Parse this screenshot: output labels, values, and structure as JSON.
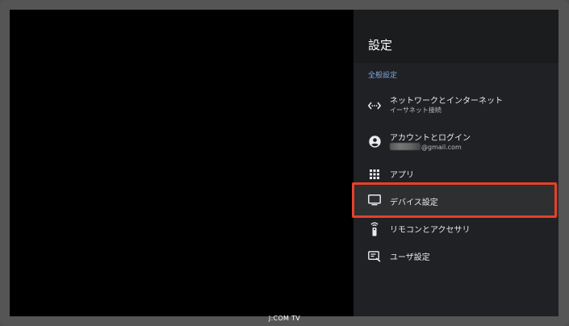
{
  "panel": {
    "title": "設定",
    "section": "全般設定",
    "items": [
      {
        "label": "ネットワークとインターネット",
        "sub": "イーサネット接続",
        "icon": "network-icon"
      },
      {
        "label": "アカウントとログイン",
        "sub": "@gmail.com",
        "icon": "account-icon"
      },
      {
        "label": "アプリ",
        "icon": "apps-grid-icon"
      },
      {
        "label": "デバイス設定",
        "icon": "tv-icon"
      },
      {
        "label": "リモコンとアクセサリ",
        "icon": "remote-icon"
      },
      {
        "label": "ユーザ設定",
        "icon": "user-settings-icon"
      }
    ]
  },
  "brand": "J:COM TV",
  "colors": {
    "highlight": "#e8402a",
    "section": "#7fa7e0",
    "panel": "#202124"
  }
}
